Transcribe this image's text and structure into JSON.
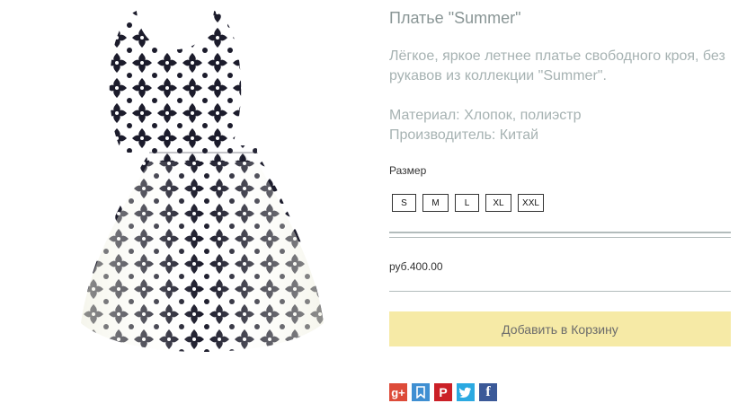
{
  "product": {
    "title": "Платье \"Summer\"",
    "description": "Лёгкое, яркое летнее платье свободного кроя, без рукавов из коллекции \"Summer\".",
    "material": "Материал: Хлопок, полиэстр",
    "manufacturer": "Производитель: Китай",
    "size_label": "Размер",
    "sizes": [
      "S",
      "M",
      "L",
      "XL",
      "XXL"
    ],
    "price": "руб.400.00",
    "add_to_cart_label": "Добавить в Корзину"
  },
  "image": {
    "icon": "dress-image",
    "fabric_color": "#ffffff",
    "pattern_color": "#1c1c2c",
    "shade_color": "#eeeedd"
  },
  "social": [
    {
      "icon": "google-plus-icon",
      "glyph": "g+",
      "color": "#dd4b39"
    },
    {
      "icon": "bookmark-icon",
      "glyph": "🔖",
      "color": "#3f8fd2"
    },
    {
      "icon": "pinterest-icon",
      "glyph": "P",
      "color": "#cb2027"
    },
    {
      "icon": "twitter-icon",
      "glyph": "t",
      "color": "#2ba9e1"
    },
    {
      "icon": "facebook-icon",
      "glyph": "f",
      "color": "#3b5998"
    }
  ],
  "colors": {
    "title": "#8a9696",
    "text": "#a6b2b2",
    "divider": "#b3bcbc",
    "button_bg": "#f6eaa6"
  }
}
